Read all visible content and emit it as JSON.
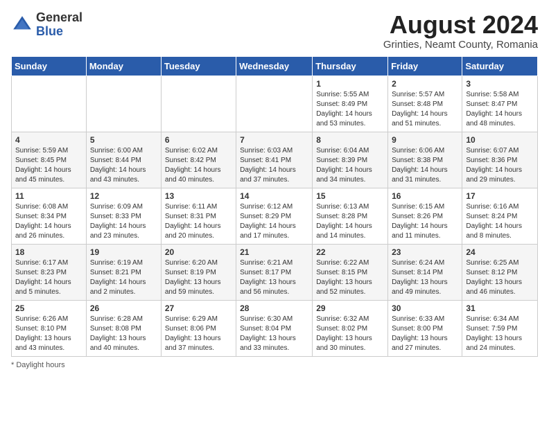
{
  "header": {
    "logo": {
      "general": "General",
      "blue": "Blue"
    },
    "title": "August 2024",
    "subtitle": "Grinties, Neamt County, Romania"
  },
  "calendar": {
    "days_of_week": [
      "Sunday",
      "Monday",
      "Tuesday",
      "Wednesday",
      "Thursday",
      "Friday",
      "Saturday"
    ],
    "weeks": [
      [
        {
          "day": "",
          "info": ""
        },
        {
          "day": "",
          "info": ""
        },
        {
          "day": "",
          "info": ""
        },
        {
          "day": "",
          "info": ""
        },
        {
          "day": "1",
          "info": "Sunrise: 5:55 AM\nSunset: 8:49 PM\nDaylight: 14 hours\nand 53 minutes."
        },
        {
          "day": "2",
          "info": "Sunrise: 5:57 AM\nSunset: 8:48 PM\nDaylight: 14 hours\nand 51 minutes."
        },
        {
          "day": "3",
          "info": "Sunrise: 5:58 AM\nSunset: 8:47 PM\nDaylight: 14 hours\nand 48 minutes."
        }
      ],
      [
        {
          "day": "4",
          "info": "Sunrise: 5:59 AM\nSunset: 8:45 PM\nDaylight: 14 hours\nand 45 minutes."
        },
        {
          "day": "5",
          "info": "Sunrise: 6:00 AM\nSunset: 8:44 PM\nDaylight: 14 hours\nand 43 minutes."
        },
        {
          "day": "6",
          "info": "Sunrise: 6:02 AM\nSunset: 8:42 PM\nDaylight: 14 hours\nand 40 minutes."
        },
        {
          "day": "7",
          "info": "Sunrise: 6:03 AM\nSunset: 8:41 PM\nDaylight: 14 hours\nand 37 minutes."
        },
        {
          "day": "8",
          "info": "Sunrise: 6:04 AM\nSunset: 8:39 PM\nDaylight: 14 hours\nand 34 minutes."
        },
        {
          "day": "9",
          "info": "Sunrise: 6:06 AM\nSunset: 8:38 PM\nDaylight: 14 hours\nand 31 minutes."
        },
        {
          "day": "10",
          "info": "Sunrise: 6:07 AM\nSunset: 8:36 PM\nDaylight: 14 hours\nand 29 minutes."
        }
      ],
      [
        {
          "day": "11",
          "info": "Sunrise: 6:08 AM\nSunset: 8:34 PM\nDaylight: 14 hours\nand 26 minutes."
        },
        {
          "day": "12",
          "info": "Sunrise: 6:09 AM\nSunset: 8:33 PM\nDaylight: 14 hours\nand 23 minutes."
        },
        {
          "day": "13",
          "info": "Sunrise: 6:11 AM\nSunset: 8:31 PM\nDaylight: 14 hours\nand 20 minutes."
        },
        {
          "day": "14",
          "info": "Sunrise: 6:12 AM\nSunset: 8:29 PM\nDaylight: 14 hours\nand 17 minutes."
        },
        {
          "day": "15",
          "info": "Sunrise: 6:13 AM\nSunset: 8:28 PM\nDaylight: 14 hours\nand 14 minutes."
        },
        {
          "day": "16",
          "info": "Sunrise: 6:15 AM\nSunset: 8:26 PM\nDaylight: 14 hours\nand 11 minutes."
        },
        {
          "day": "17",
          "info": "Sunrise: 6:16 AM\nSunset: 8:24 PM\nDaylight: 14 hours\nand 8 minutes."
        }
      ],
      [
        {
          "day": "18",
          "info": "Sunrise: 6:17 AM\nSunset: 8:23 PM\nDaylight: 14 hours\nand 5 minutes."
        },
        {
          "day": "19",
          "info": "Sunrise: 6:19 AM\nSunset: 8:21 PM\nDaylight: 14 hours\nand 2 minutes."
        },
        {
          "day": "20",
          "info": "Sunrise: 6:20 AM\nSunset: 8:19 PM\nDaylight: 13 hours\nand 59 minutes."
        },
        {
          "day": "21",
          "info": "Sunrise: 6:21 AM\nSunset: 8:17 PM\nDaylight: 13 hours\nand 56 minutes."
        },
        {
          "day": "22",
          "info": "Sunrise: 6:22 AM\nSunset: 8:15 PM\nDaylight: 13 hours\nand 52 minutes."
        },
        {
          "day": "23",
          "info": "Sunrise: 6:24 AM\nSunset: 8:14 PM\nDaylight: 13 hours\nand 49 minutes."
        },
        {
          "day": "24",
          "info": "Sunrise: 6:25 AM\nSunset: 8:12 PM\nDaylight: 13 hours\nand 46 minutes."
        }
      ],
      [
        {
          "day": "25",
          "info": "Sunrise: 6:26 AM\nSunset: 8:10 PM\nDaylight: 13 hours\nand 43 minutes."
        },
        {
          "day": "26",
          "info": "Sunrise: 6:28 AM\nSunset: 8:08 PM\nDaylight: 13 hours\nand 40 minutes."
        },
        {
          "day": "27",
          "info": "Sunrise: 6:29 AM\nSunset: 8:06 PM\nDaylight: 13 hours\nand 37 minutes."
        },
        {
          "day": "28",
          "info": "Sunrise: 6:30 AM\nSunset: 8:04 PM\nDaylight: 13 hours\nand 33 minutes."
        },
        {
          "day": "29",
          "info": "Sunrise: 6:32 AM\nSunset: 8:02 PM\nDaylight: 13 hours\nand 30 minutes."
        },
        {
          "day": "30",
          "info": "Sunrise: 6:33 AM\nSunset: 8:00 PM\nDaylight: 13 hours\nand 27 minutes."
        },
        {
          "day": "31",
          "info": "Sunrise: 6:34 AM\nSunset: 7:59 PM\nDaylight: 13 hours\nand 24 minutes."
        }
      ]
    ]
  },
  "footer": {
    "note": "Daylight hours"
  }
}
